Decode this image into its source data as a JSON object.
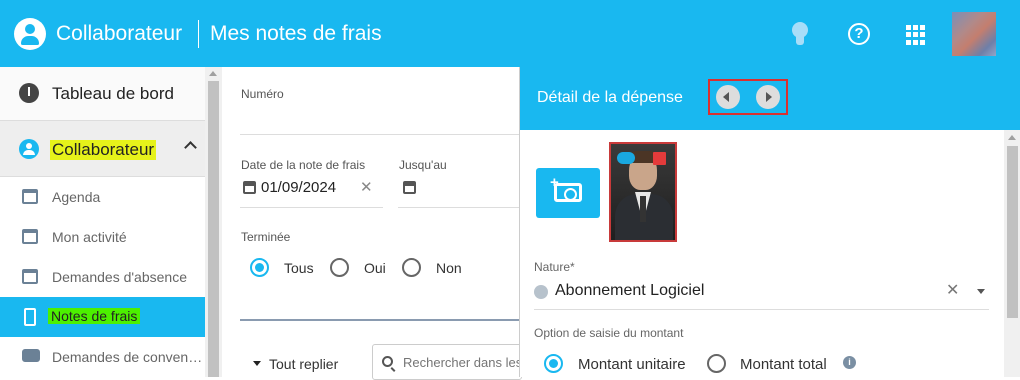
{
  "header": {
    "module": "Collaborateur",
    "page_title": "Mes notes de frais",
    "icons": [
      "user-circle-icon",
      "lightbulb-icon",
      "help-icon",
      "apps-grid-icon"
    ],
    "accent_color": "#19b8f0"
  },
  "sidebar": {
    "dashboard_label": "Tableau de bord",
    "section_label": "Collaborateur",
    "items": [
      {
        "label": "Agenda",
        "icon": "calendar-clock-icon"
      },
      {
        "label": "Mon activité",
        "icon": "calendar-user-icon"
      },
      {
        "label": "Demandes d'absence",
        "icon": "calendar-x-icon"
      },
      {
        "label": "Notes de frais",
        "icon": "receipt-icon",
        "active": true
      },
      {
        "label": "Demandes de conven…",
        "icon": "chat-icon"
      }
    ]
  },
  "form": {
    "numero_label": "Numéro",
    "date_label": "Date de la note de frais",
    "date_value": "01/09/2024",
    "until_label": "Jusqu'au",
    "terminee_label": "Terminée",
    "radios": [
      {
        "label": "Tous",
        "checked": true
      },
      {
        "label": "Oui",
        "checked": false
      },
      {
        "label": "Non",
        "checked": false
      }
    ],
    "collapse_label": "Tout replier",
    "search_placeholder": "Rechercher dans les"
  },
  "detail": {
    "title": "Détail de la dépense",
    "nature_label": "Nature*",
    "nature_value": "Abonnement Logiciel",
    "amount_option_label": "Option de saisie du montant",
    "amount_options": [
      {
        "label": "Montant unitaire",
        "checked": true
      },
      {
        "label": "Montant total",
        "checked": false
      }
    ]
  }
}
